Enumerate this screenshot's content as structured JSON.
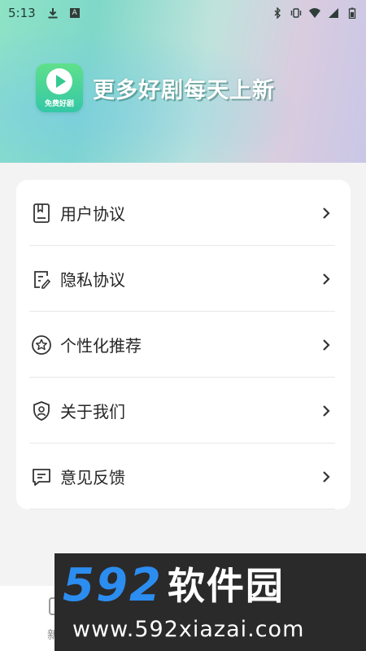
{
  "status_bar": {
    "time": "5:13",
    "left_icons": [
      "download-icon",
      "a-badge-icon"
    ],
    "a_badge_text": "A",
    "right_icons": [
      "bluetooth-icon",
      "vibrate-icon",
      "wifi-icon",
      "signal-icon",
      "battery-icon"
    ]
  },
  "header": {
    "logo_label": "免费好剧",
    "slogan": "更多好剧每天上新"
  },
  "menu": {
    "items": [
      {
        "label": "用户协议",
        "icon": "book-icon"
      },
      {
        "label": "隐私协议",
        "icon": "document-edit-icon"
      },
      {
        "label": "个性化推荐",
        "icon": "star-circle-icon"
      },
      {
        "label": "关于我们",
        "icon": "shield-user-icon"
      },
      {
        "label": "意见反馈",
        "icon": "message-icon"
      }
    ]
  },
  "bottom_nav": {
    "visible_label": "新"
  },
  "watermark": {
    "number": "592",
    "brand": "软件园",
    "url": "www.592xiazai.com"
  }
}
